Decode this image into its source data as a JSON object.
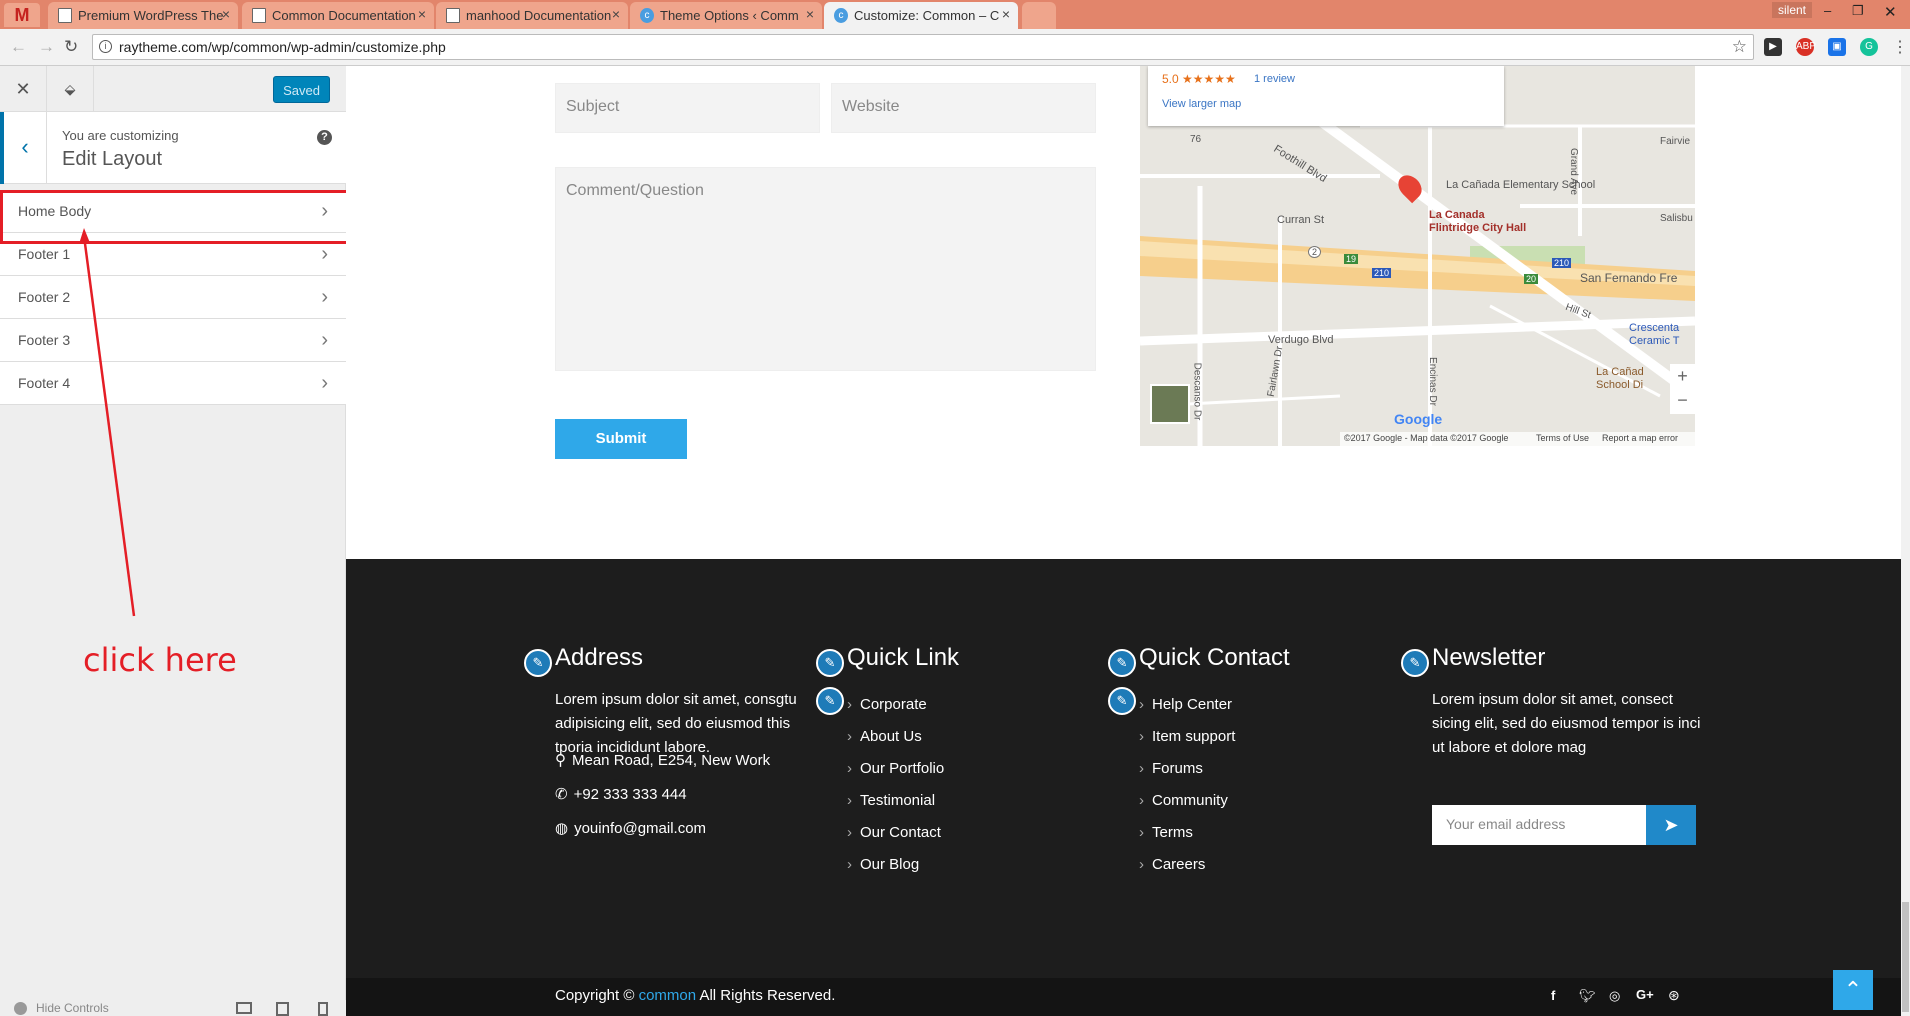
{
  "browser": {
    "tabs": [
      {
        "label": "Premium WordPress The"
      },
      {
        "label": "Common Documentation"
      },
      {
        "label": "manhood Documentation"
      },
      {
        "label": "Theme Options ‹ Comm"
      },
      {
        "label": "Customize: Common – C"
      }
    ],
    "profile": "silent",
    "url": "raytheme.com/wp/common/wp-admin/customize.php"
  },
  "customizer": {
    "saved_label": "Saved",
    "customizing_label": "You are customizing",
    "section_title": "Edit Layout",
    "sections": [
      {
        "label": "Home Body"
      },
      {
        "label": "Footer 1"
      },
      {
        "label": "Footer 2"
      },
      {
        "label": "Footer 3"
      },
      {
        "label": "Footer 4"
      }
    ],
    "annotation": "click here",
    "hide_controls": "Hide Controls"
  },
  "form": {
    "subject_placeholder": "Subject",
    "website_placeholder": "Website",
    "comment_placeholder": "Comment/Question",
    "submit_label": "Submit"
  },
  "map": {
    "rating": "5.0 ★★★★★",
    "reviews": "1 review",
    "larger_map": "View larger map",
    "labels": {
      "school": "La Cañada Elementary School",
      "cityhall_1": "La Canada",
      "cityhall_2": "Flintridge City Hall",
      "foothill": "Foothill Blvd",
      "curran": "Curran St",
      "verdugo": "Verdugo Blvd",
      "sanfernando": "San Fernando Fre",
      "crescenta": "Crescenta",
      "ceramic": "Ceramic T",
      "lacanada_school_1": "La Cañad",
      "lacanada_school_2": "School Di",
      "fairview": "Fairvie",
      "salisbury": "Salisbu",
      "grand": "Grand Ave",
      "descanso": "Descanso Dr",
      "fairlawn": "Fairlawn Dr",
      "encinas": "Encinas Dr",
      "hill": "Hill St",
      "route76": "76",
      "route2": "2",
      "route19": "19",
      "route210a": "210",
      "route210b": "210",
      "route20": "20",
      "google": "Google",
      "attribution": "©2017 Google - Map data ©2017 Google",
      "terms": "Terms of Use",
      "report": "Report a map error"
    }
  },
  "footer": {
    "address": {
      "title": "Address",
      "text": "Lorem ipsum dolor sit amet, consgtu adipisicing elit, sed do eiusmod this tporia incididunt labore.",
      "street": "Mean Road, E254, New Work",
      "phone": "+92 333 333 444",
      "email": "youinfo@gmail.com"
    },
    "quick_link": {
      "title": "Quick Link",
      "items": [
        "Corporate",
        "About Us",
        "Our Portfolio",
        "Testimonial",
        "Our Contact",
        "Our Blog"
      ]
    },
    "quick_contact": {
      "title": "Quick Contact",
      "items": [
        "Help Center",
        "Item support",
        "Forums",
        "Community",
        "Terms",
        "Careers"
      ]
    },
    "newsletter": {
      "title": "Newsletter",
      "text": "Lorem ipsum dolor sit amet, consect sicing elit, sed do eiusmod tempor is inci ut labore et dolore mag",
      "email_placeholder": "Your email address"
    },
    "copyright_prefix": "Copyright ©",
    "copyright_brand": "common",
    "copyright_suffix": "All Rights Reserved.",
    "social": [
      "facebook-icon",
      "twitter-icon",
      "instagram-icon",
      "google-plus-icon",
      "dribbble-icon"
    ]
  },
  "colors": {
    "accent": "#2fa8e9",
    "customizer_blue": "#0085ba",
    "footer_bg": "#1d1d1d",
    "annotation_red": "#e41e26"
  }
}
